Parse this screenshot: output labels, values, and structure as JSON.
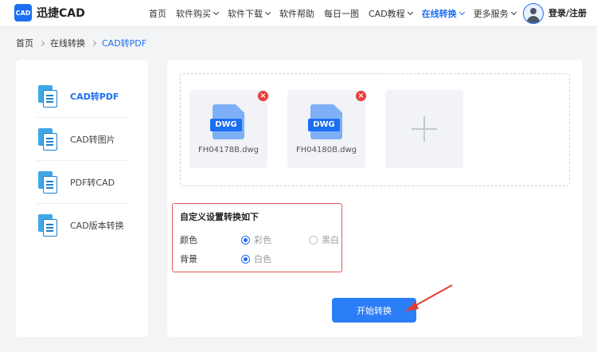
{
  "header": {
    "logo_mark": "CAD",
    "logo_text": "迅捷CAD",
    "nav": [
      {
        "label": "首页",
        "dropdown": false,
        "active": false
      },
      {
        "label": "软件购买",
        "dropdown": true,
        "active": false
      },
      {
        "label": "软件下载",
        "dropdown": true,
        "active": false
      },
      {
        "label": "软件帮助",
        "dropdown": false,
        "active": false
      },
      {
        "label": "每日一图",
        "dropdown": false,
        "active": false
      },
      {
        "label": "CAD教程",
        "dropdown": true,
        "active": false
      },
      {
        "label": "在线转换",
        "dropdown": true,
        "active": true
      },
      {
        "label": "更多服务",
        "dropdown": true,
        "active": false
      }
    ],
    "login": "登录/注册"
  },
  "breadcrumb": [
    "首页",
    "在线转换",
    "CAD转PDF"
  ],
  "sidebar": {
    "items": [
      {
        "label": "CAD转PDF",
        "active": true
      },
      {
        "label": "CAD转图片",
        "active": false
      },
      {
        "label": "PDF转CAD",
        "active": false
      },
      {
        "label": "CAD版本转换",
        "active": false
      }
    ]
  },
  "files": [
    {
      "name": "FH04178B.dwg",
      "type_tag": "DWG"
    },
    {
      "name": "FH04180B.dwg",
      "type_tag": "DWG"
    }
  ],
  "settings": {
    "title": "自定义设置转换如下",
    "color_label": "颜色",
    "color_options": [
      "彩色",
      "黑白"
    ],
    "color_selected": "彩色",
    "background_label": "背景",
    "background_options": [
      "白色"
    ],
    "background_selected": "白色"
  },
  "start_button": "开始转换",
  "colors": {
    "accent": "#1d6ff2",
    "button": "#2c7ef8",
    "highlight_border": "#e05a5a",
    "close_badge": "#ee3b3b",
    "arrow": "#e03c2e"
  }
}
